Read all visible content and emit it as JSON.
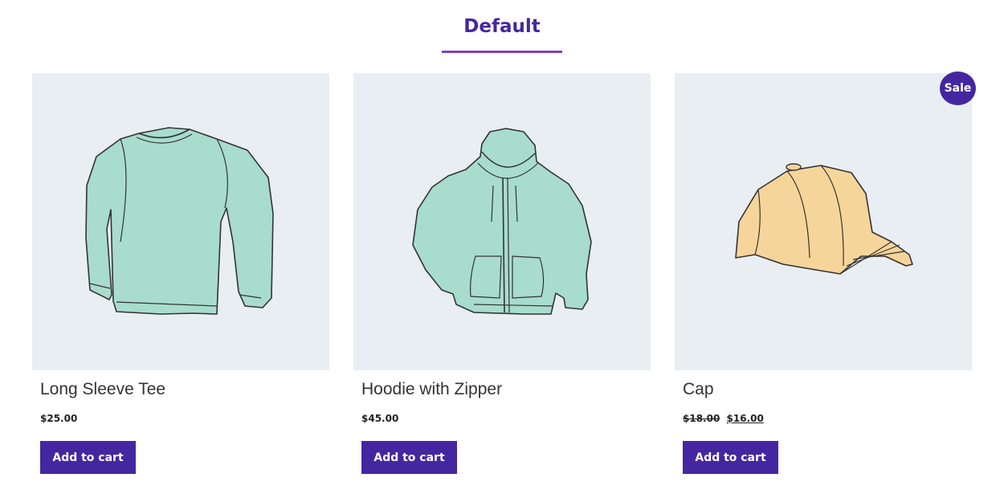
{
  "tab": {
    "title": "Default"
  },
  "colors": {
    "accent": "#4427a0",
    "underline": "#7b44b8",
    "image_bg": "#e9eef3",
    "mint": "#a8dccd",
    "cap": "#f6d59a"
  },
  "products": [
    {
      "title": "Long Sleeve Tee",
      "price": "$25.00",
      "button": "Add to cart",
      "image_icon": "long-sleeve-tee-icon"
    },
    {
      "title": "Hoodie with Zipper",
      "price": "$45.00",
      "button": "Add to cart",
      "image_icon": "hoodie-icon"
    },
    {
      "title": "Cap",
      "old_price": "$18.00",
      "price": "$16.00",
      "button": "Add to cart",
      "badge": "Sale",
      "image_icon": "cap-icon"
    }
  ]
}
